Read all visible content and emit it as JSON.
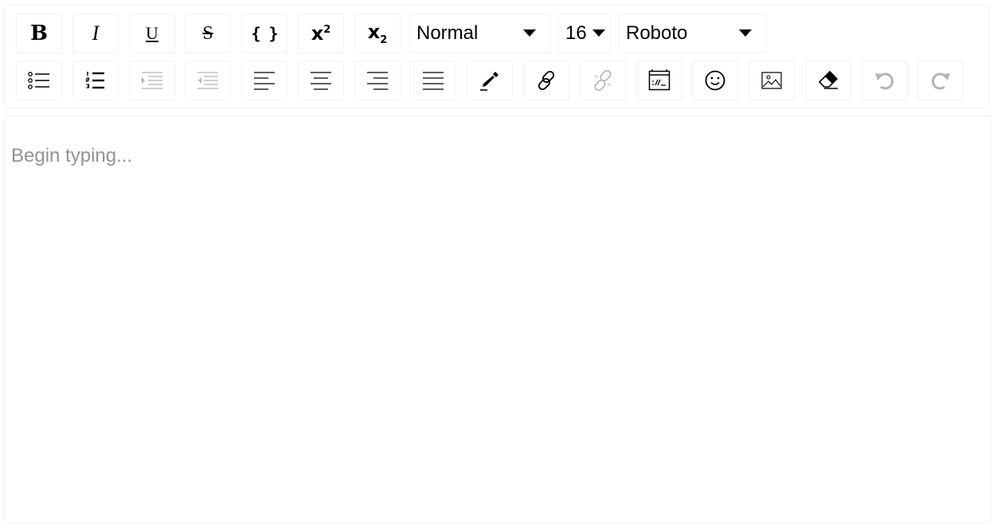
{
  "toolbar": {
    "inline": [
      {
        "name": "bold-button",
        "icon": "bold-icon",
        "glyph": "B"
      },
      {
        "name": "italic-button",
        "icon": "italic-icon",
        "glyph": "I"
      },
      {
        "name": "underline-button",
        "icon": "underline-icon",
        "glyph": "U"
      },
      {
        "name": "strikethrough-button",
        "icon": "strikethrough-icon",
        "glyph": "S"
      },
      {
        "name": "code-button",
        "icon": "code-braces-icon",
        "glyph": "{ }"
      },
      {
        "name": "superscript-button",
        "icon": "superscript-icon",
        "glyph": "x",
        "script": "2"
      },
      {
        "name": "subscript-button",
        "icon": "subscript-icon",
        "glyph": "x",
        "script": "2"
      }
    ],
    "block_type": {
      "value": "Normal"
    },
    "font_size": {
      "value": "16"
    },
    "font_family": {
      "value": "Roboto"
    },
    "row2_icons": [
      "unordered-list-icon",
      "ordered-list-icon",
      "indent-icon",
      "outdent-icon",
      "align-left-icon",
      "align-center-icon",
      "align-right-icon",
      "align-justify-icon",
      "color-picker-icon",
      "link-icon",
      "unlink-icon",
      "embed-icon",
      "emoji-icon",
      "image-icon",
      "eraser-icon",
      "undo-icon",
      "redo-icon"
    ],
    "disabled": [
      "indent-icon",
      "outdent-icon",
      "unlink-icon",
      "undo-icon",
      "redo-icon"
    ],
    "colors": {
      "enabled_icon": "#000000",
      "disabled_icon": "#b4b4b4",
      "border": "#f1f1f1"
    }
  },
  "editor": {
    "placeholder": "Begin typing...",
    "placeholder_color": "#8e939b"
  }
}
